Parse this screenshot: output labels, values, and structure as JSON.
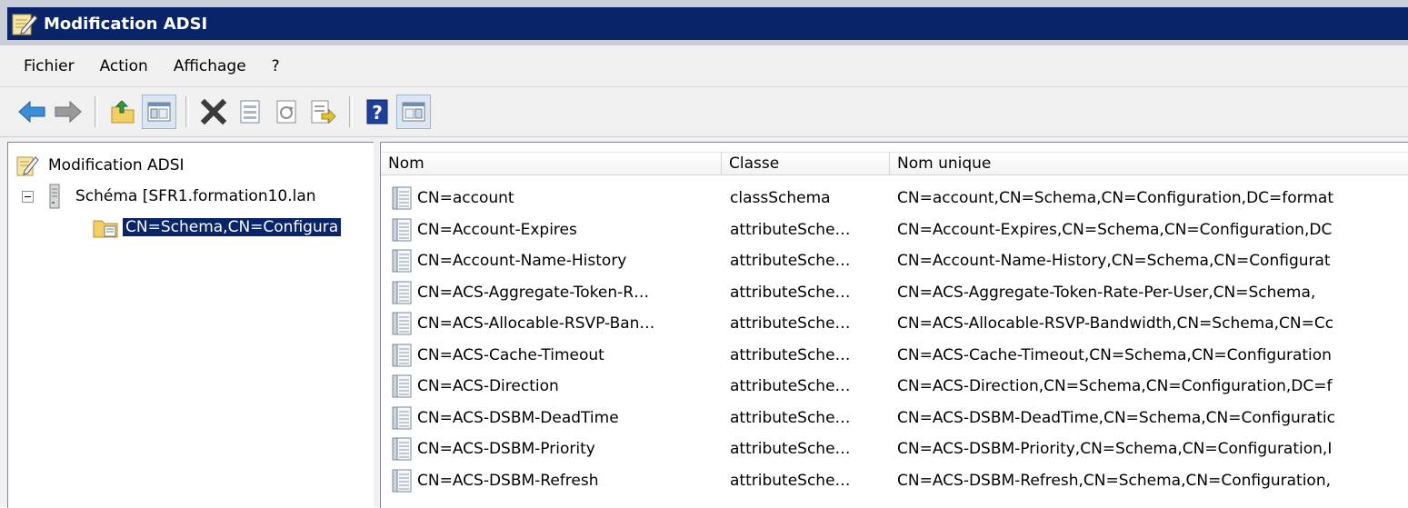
{
  "window": {
    "title": "Modification ADSI"
  },
  "menu": {
    "items": [
      "Fichier",
      "Action",
      "Affichage",
      "?"
    ]
  },
  "toolbar": {
    "buttons": [
      "back-arrow-icon",
      "forward-arrow-icon",
      "up-folder-icon",
      "show-hide-tree-icon",
      "delete-icon",
      "properties-icon",
      "refresh-icon",
      "export-list-icon",
      "help-icon",
      "show-action-pane-icon"
    ]
  },
  "tree": {
    "root": "Modification ADSI",
    "server": "Schéma [SFR1.formation10.lan",
    "selected": "CN=Schema,CN=Configura"
  },
  "list": {
    "columns": {
      "nom": "Nom",
      "classe": "Classe",
      "unique": "Nom unique"
    },
    "rows": [
      {
        "nom": "CN=account",
        "classe": "classSchema",
        "unique": "CN=account,CN=Schema,CN=Configuration,DC=format"
      },
      {
        "nom": "CN=Account-Expires",
        "classe": "attributeSche…",
        "unique": "CN=Account-Expires,CN=Schema,CN=Configuration,DC"
      },
      {
        "nom": "CN=Account-Name-History",
        "classe": "attributeSche…",
        "unique": "CN=Account-Name-History,CN=Schema,CN=Configurat"
      },
      {
        "nom": "CN=ACS-Aggregate-Token-R…",
        "classe": "attributeSche…",
        "unique": "CN=ACS-Aggregate-Token-Rate-Per-User,CN=Schema,"
      },
      {
        "nom": "CN=ACS-Allocable-RSVP-Ban…",
        "classe": "attributeSche…",
        "unique": "CN=ACS-Allocable-RSVP-Bandwidth,CN=Schema,CN=Cc"
      },
      {
        "nom": "CN=ACS-Cache-Timeout",
        "classe": "attributeSche…",
        "unique": "CN=ACS-Cache-Timeout,CN=Schema,CN=Configuration"
      },
      {
        "nom": "CN=ACS-Direction",
        "classe": "attributeSche…",
        "unique": "CN=ACS-Direction,CN=Schema,CN=Configuration,DC=f"
      },
      {
        "nom": "CN=ACS-DSBM-DeadTime",
        "classe": "attributeSche…",
        "unique": "CN=ACS-DSBM-DeadTime,CN=Schema,CN=Configuratic"
      },
      {
        "nom": "CN=ACS-DSBM-Priority",
        "classe": "attributeSche…",
        "unique": "CN=ACS-DSBM-Priority,CN=Schema,CN=Configuration,I"
      },
      {
        "nom": "CN=ACS-DSBM-Refresh",
        "classe": "attributeSche…",
        "unique": "CN=ACS-DSBM-Refresh,CN=Schema,CN=Configuration,"
      }
    ]
  },
  "colors": {
    "title_bg": "#0a246a",
    "selection_bg": "#0a246a",
    "chrome_bg": "#f0f0f0"
  }
}
